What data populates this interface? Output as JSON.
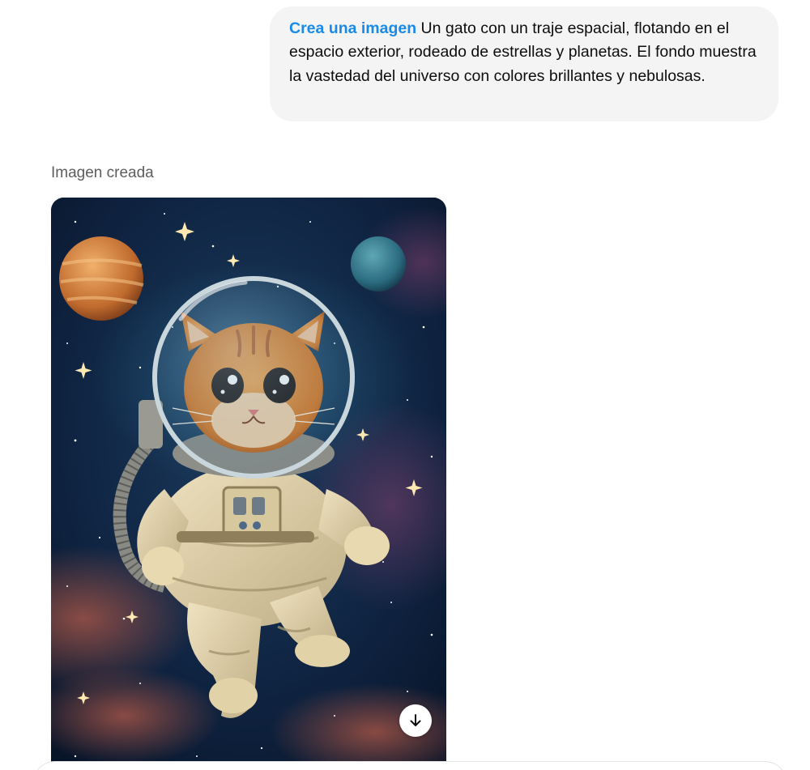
{
  "conversation": {
    "user_message": {
      "tag": "Crea una imagen",
      "text": " Un gato con un traje espacial, flotando en el espacio exterior, rodeado de estrellas y planetas. El fondo muestra la vastedad del universo con colores brillantes y nebulosas."
    },
    "assistant_message": {
      "status_label": "Imagen creada",
      "image": {
        "subject": "cat-astronaut-illustration",
        "download_icon": "arrow-down-icon"
      }
    }
  },
  "colors": {
    "tag_accent": "#1a8ae8",
    "bubble_bg": "#f4f4f4",
    "space_bg": "#0b1a33",
    "label_gray": "#5d5d5d"
  }
}
